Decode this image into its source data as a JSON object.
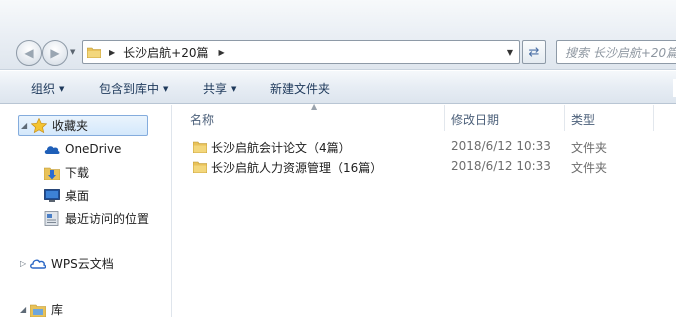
{
  "address_bar": {
    "crumb": "长沙启航+20篇"
  },
  "search": {
    "placeholder": "搜索 长沙启航+20篇"
  },
  "toolbar": {
    "organize": "组织",
    "include_in_library": "包含到库中",
    "share": "共享",
    "new_folder": "新建文件夹"
  },
  "sidebar": {
    "favorites": "收藏夹",
    "items": [
      {
        "label": "OneDrive",
        "icon": "onedrive-icon"
      },
      {
        "label": "下载",
        "icon": "downloads-icon"
      },
      {
        "label": "桌面",
        "icon": "desktop-icon"
      },
      {
        "label": "最近访问的位置",
        "icon": "recent-places-icon"
      }
    ],
    "wps": "WPS云文档",
    "library": "库"
  },
  "columns": {
    "name": "名称",
    "date": "修改日期",
    "type": "类型"
  },
  "files": [
    {
      "name": "长沙启航会计论文（4篇）",
      "date": "2018/6/12 10:33",
      "type": "文件夹"
    },
    {
      "name": "长沙启航人力资源管理（16篇）",
      "date": "2018/6/12 10:33",
      "type": "文件夹"
    }
  ],
  "colors": {
    "folder": "#e8c25a",
    "selection": "#d4e8fb",
    "header_text": "#4c607a"
  }
}
